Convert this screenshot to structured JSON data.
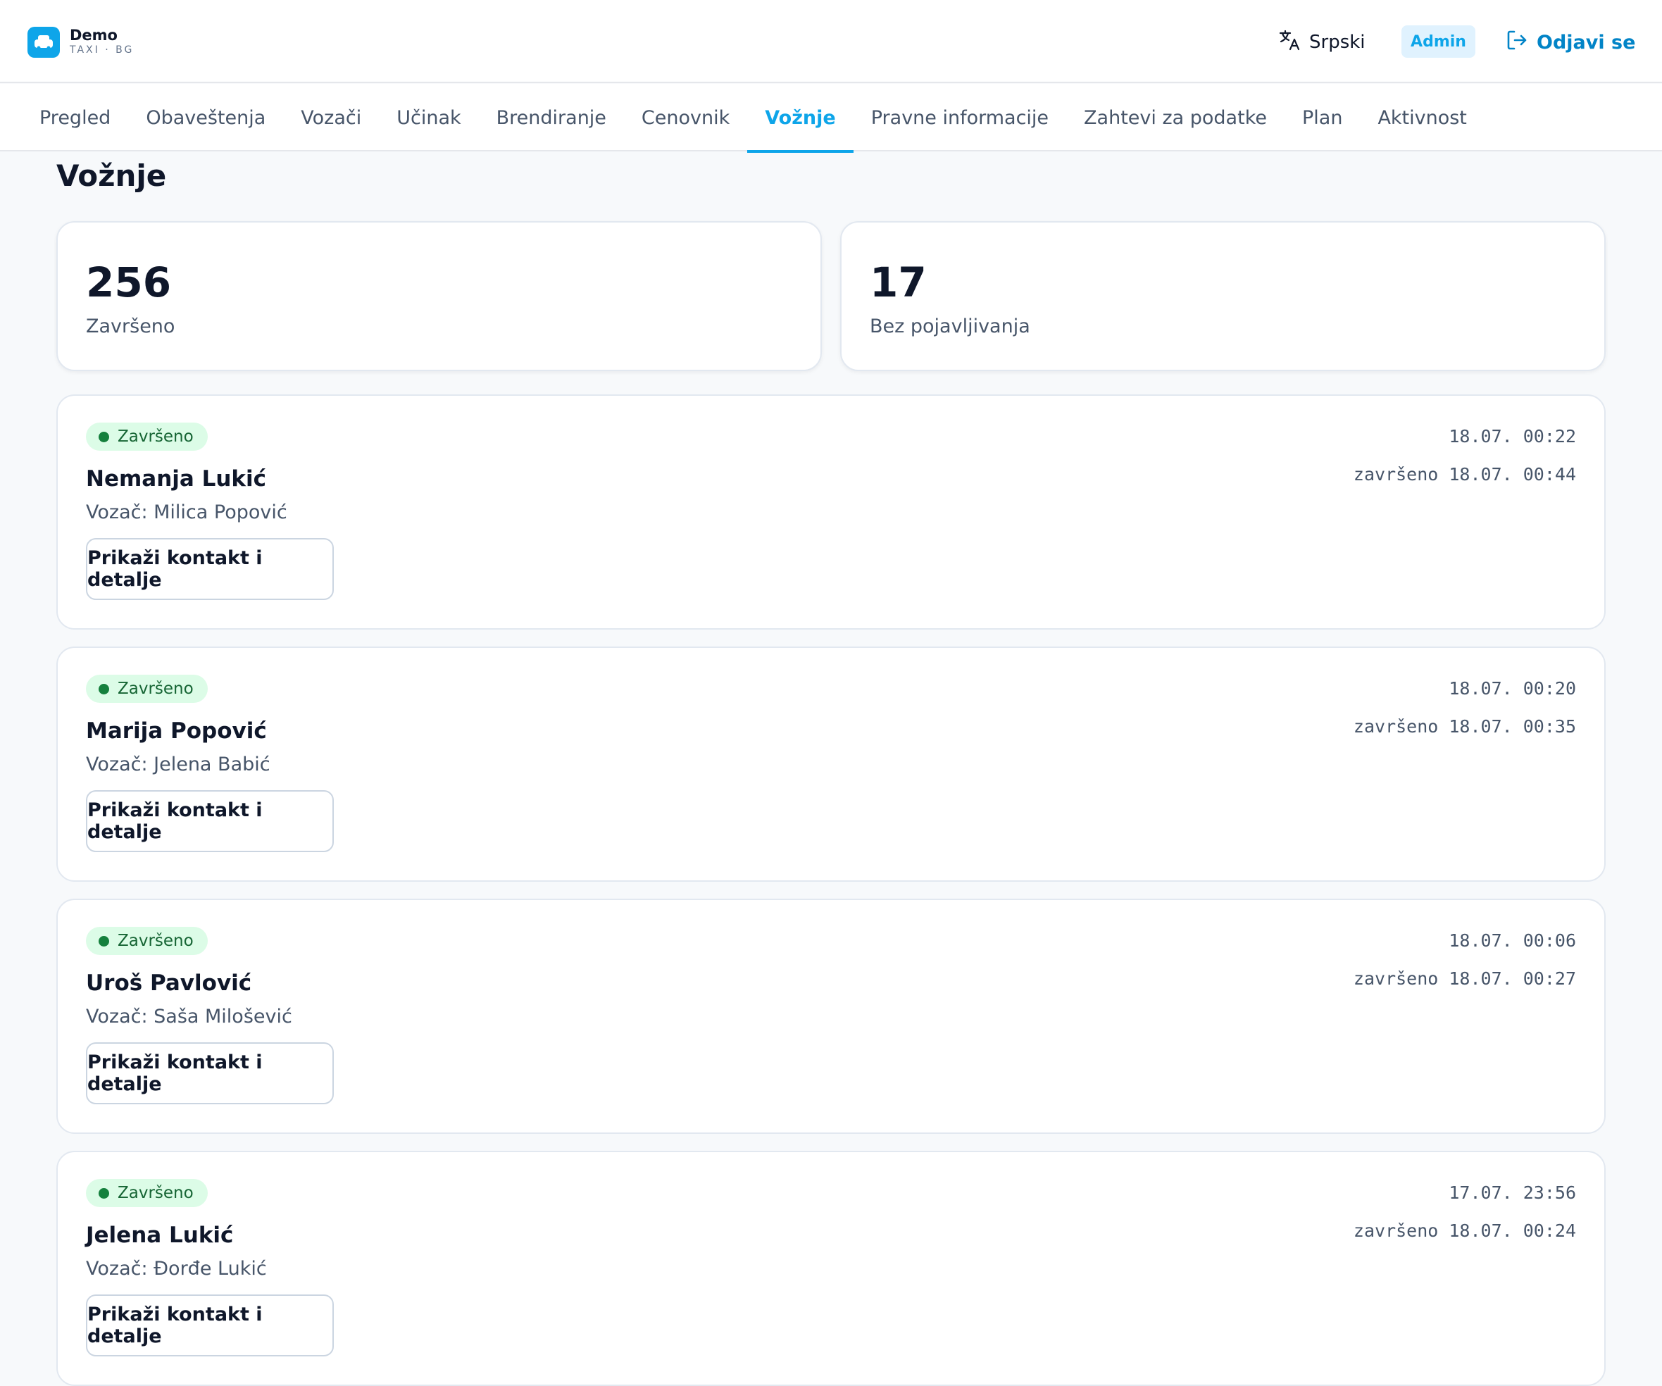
{
  "header": {
    "brand_name": "Demo",
    "brand_sub": "TAXI · BG",
    "language_label": "Srpski",
    "role_badge": "Admin",
    "logout_label": "Odjavi se",
    "accent_color": "#0ea5e9"
  },
  "nav": {
    "tabs": [
      {
        "label": "Pregled"
      },
      {
        "label": "Obaveštenja"
      },
      {
        "label": "Vozači"
      },
      {
        "label": "Učinak"
      },
      {
        "label": "Brendiranje"
      },
      {
        "label": "Cenovnik"
      },
      {
        "label": "Vožnje",
        "active": true
      },
      {
        "label": "Pravne informacije"
      },
      {
        "label": "Zahtevi za podatke"
      },
      {
        "label": "Plan"
      },
      {
        "label": "Aktivnost"
      }
    ]
  },
  "page": {
    "title": "Vožnje"
  },
  "stats": [
    {
      "value": "256",
      "label": "Završeno"
    },
    {
      "value": "17",
      "label": "Bez pojavljivanja"
    }
  ],
  "rides": [
    {
      "status": "Završeno",
      "passenger": "Nemanja Lukić",
      "driver_line": "Vozač: Milica Popović",
      "details_label": "Prikaži kontakt i detalje",
      "time": "18.07. 00:22",
      "finished": "završeno 18.07. 00:44"
    },
    {
      "status": "Završeno",
      "passenger": "Marija Popović",
      "driver_line": "Vozač: Jelena Babić",
      "details_label": "Prikaži kontakt i detalje",
      "time": "18.07. 00:20",
      "finished": "završeno 18.07. 00:35"
    },
    {
      "status": "Završeno",
      "passenger": "Uroš Pavlović",
      "driver_line": "Vozač: Saša Milošević",
      "details_label": "Prikaži kontakt i detalje",
      "time": "18.07. 00:06",
      "finished": "završeno 18.07. 00:27"
    },
    {
      "status": "Završeno",
      "passenger": "Jelena Lukić",
      "driver_line": "Vozač: Đorđe Lukić",
      "details_label": "Prikaži kontakt i detalje",
      "time": "17.07. 23:56",
      "finished": "završeno 18.07. 00:24"
    }
  ],
  "icons": {
    "logo": "taxi-car-icon",
    "language": "translate-icon",
    "logout": "logout-icon"
  }
}
